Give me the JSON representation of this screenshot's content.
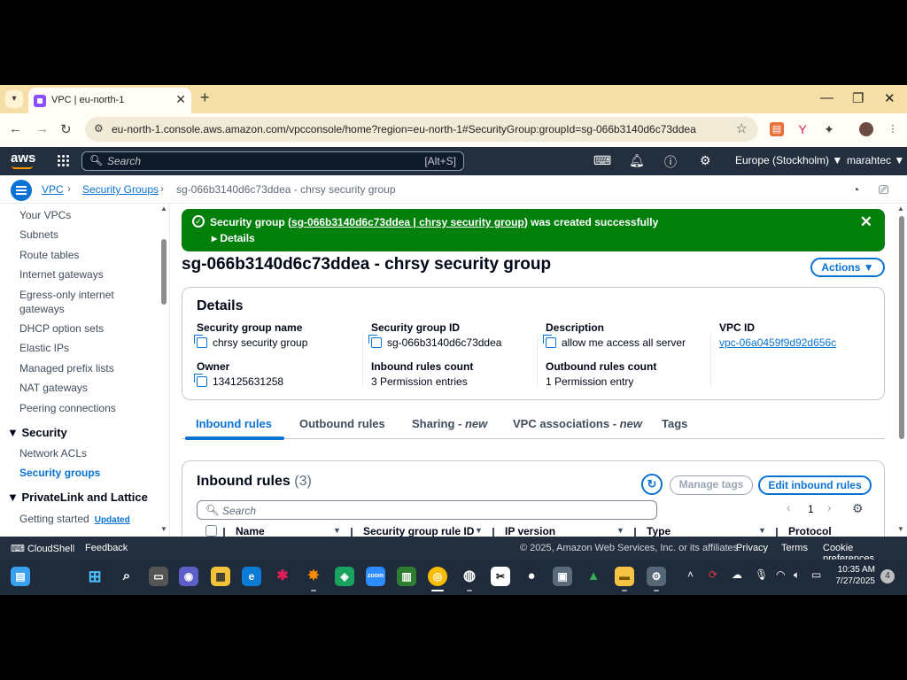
{
  "browser": {
    "tab_title": "VPC | eu-north-1",
    "url": "eu-north-1.console.aws.amazon.com/vpcconsole/home?region=eu-north-1#SecurityGroup:groupId=sg-066b3140d6c73ddea"
  },
  "aws_nav": {
    "logo": "aws",
    "search_placeholder": "Search",
    "search_shortcut": "[Alt+S]",
    "region": "Europe (Stockholm) ▼",
    "account": "marahtec ▼"
  },
  "breadcrumb": {
    "items": [
      "VPC",
      "Security Groups"
    ],
    "current": "sg-066b3140d6c73ddea - chrsy security group"
  },
  "sidebar": {
    "items": [
      "Your VPCs",
      "Subnets",
      "Route tables",
      "Internet gateways",
      "Egress-only internet gateways",
      "DHCP option sets",
      "Elastic IPs",
      "Managed prefix lists",
      "NAT gateways",
      "Peering connections"
    ],
    "security_heading": "Security",
    "security_items": [
      "Network ACLs",
      "Security groups"
    ],
    "privatelink_heading": "PrivateLink and Lattice",
    "privatelink_item": "Getting started",
    "privatelink_badge": "Updated"
  },
  "flash": {
    "prefix": "Security group (",
    "link": "sg-066b3140d6c73ddea | chrsy security group",
    "suffix": ") was created successfully",
    "details": "Details"
  },
  "page": {
    "title": "sg-066b3140d6c73ddea - chrsy security group",
    "actions_label": "Actions ▼"
  },
  "details": {
    "title": "Details",
    "fields": {
      "sg_name": {
        "label": "Security group name",
        "value": "chrsy security group"
      },
      "sg_id": {
        "label": "Security group ID",
        "value": "sg-066b3140d6c73ddea"
      },
      "description": {
        "label": "Description",
        "value": "allow me access all server"
      },
      "vpc_id": {
        "label": "VPC ID",
        "value": "vpc-06a0459f9d92d656c"
      },
      "owner": {
        "label": "Owner",
        "value": "134125631258"
      },
      "inbound_count": {
        "label": "Inbound rules count",
        "value": "3 Permission entries"
      },
      "outbound_count": {
        "label": "Outbound rules count",
        "value": "1 Permission entry"
      }
    }
  },
  "tabs": {
    "inbound": "Inbound rules",
    "outbound": "Outbound rules",
    "sharing": "Sharing - ",
    "sharing_new": "new",
    "vpc_assoc": "VPC associations - ",
    "vpc_assoc_new": "new",
    "tags": "Tags"
  },
  "inbound_rules": {
    "title": "Inbound rules",
    "count": "(3)",
    "manage_tags": "Manage tags",
    "edit": "Edit inbound rules",
    "search_placeholder": "Search",
    "page_number": "1",
    "columns": [
      "Name",
      "Security group rule ID",
      "IP version",
      "Type",
      "Protocol"
    ]
  },
  "footer": {
    "cloudshell": "CloudShell",
    "feedback": "Feedback",
    "copyright": "© 2025, Amazon Web Services, Inc. or its affiliates.",
    "privacy": "Privacy",
    "terms": "Terms",
    "cookies": "Cookie preferences"
  },
  "taskbar": {
    "time": "10:35 AM",
    "date": "7/27/2025",
    "notifications": "4"
  },
  "colors": {
    "aws_dark": "#232f3e",
    "aws_blue": "#0972d3",
    "success_green": "#037f0c",
    "aws_orange": "#ff9900"
  }
}
